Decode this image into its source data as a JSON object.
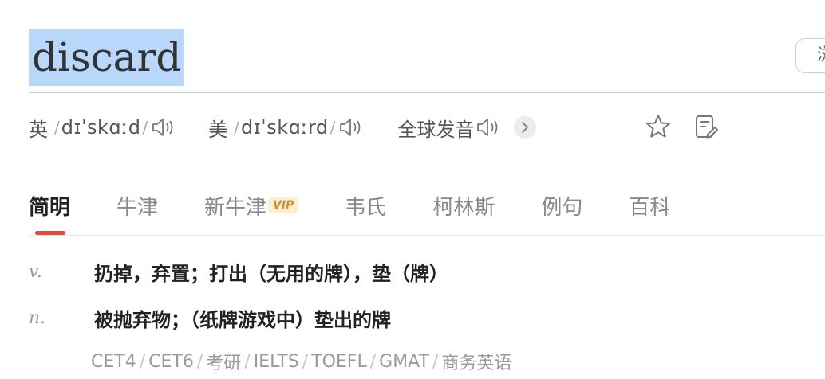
{
  "headword": "discard",
  "side_button": {
    "label": "浏"
  },
  "phonetics": {
    "uk": {
      "label": "英",
      "ipa": "dɪˈskɑːd"
    },
    "us": {
      "label": "美",
      "ipa": "dɪˈskɑːrd"
    },
    "global": {
      "label": "全球发音"
    }
  },
  "tabs": [
    {
      "label": "简明"
    },
    {
      "label": "牛津"
    },
    {
      "label": "新牛津",
      "badge": "VIP"
    },
    {
      "label": "韦氏"
    },
    {
      "label": "柯林斯"
    },
    {
      "label": "例句"
    },
    {
      "label": "百科"
    }
  ],
  "definitions": [
    {
      "pos": "v.",
      "meaning": "扔掉，弃置；打出（无用的牌），垫（牌）"
    },
    {
      "pos": "n.",
      "meaning": "被抛弃物；（纸牌游戏中）垫出的牌"
    }
  ],
  "exams": [
    "CET4",
    "CET6",
    "考研",
    "IELTS",
    "TOEFL",
    "GMAT",
    "商务英语"
  ],
  "colors": {
    "selection": "#b9d6fb",
    "accent": "#e4483e",
    "vip": "#c8962d"
  }
}
